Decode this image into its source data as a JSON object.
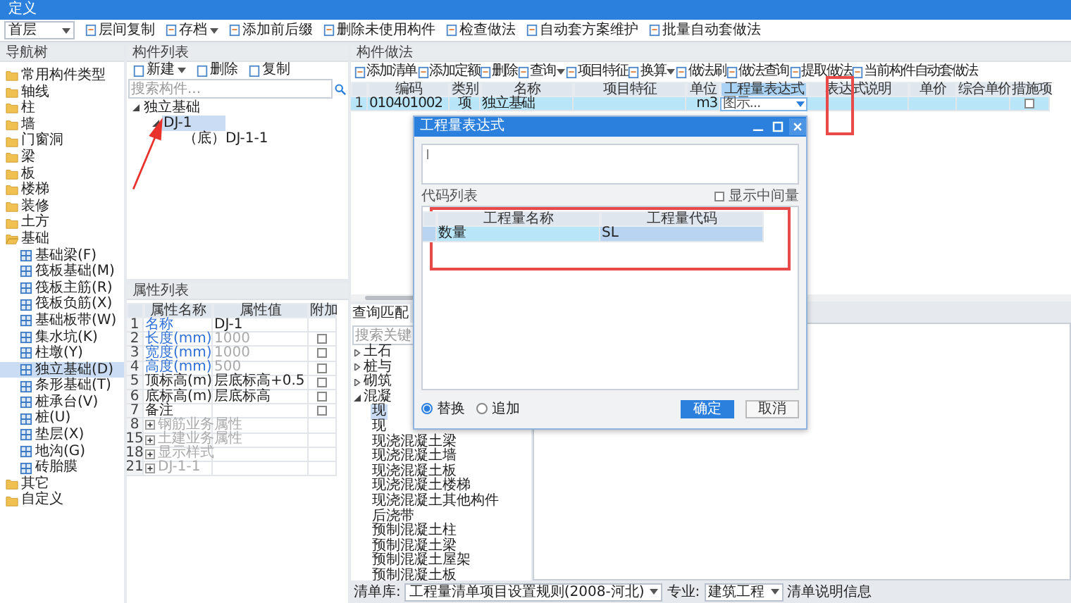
{
  "window": {
    "title": "定义"
  },
  "toolbar": {
    "floor": "首层",
    "buttons": [
      {
        "label": "层间复制",
        "dropdown": false
      },
      {
        "label": "存档",
        "dropdown": true
      },
      {
        "label": "添加前后缀",
        "dropdown": false
      },
      {
        "label": "删除未使用构件",
        "dropdown": false
      },
      {
        "label": "检查做法",
        "dropdown": false
      },
      {
        "label": "自动套方案维护",
        "dropdown": false
      },
      {
        "label": "批量自动套做法",
        "dropdown": false
      }
    ]
  },
  "nav_tree": {
    "title": "导航树",
    "items": [
      {
        "label": "常用构件类型",
        "selected": false,
        "expanded": false
      },
      {
        "label": "轴线",
        "selected": false,
        "expanded": false
      },
      {
        "label": "柱",
        "selected": false,
        "expanded": false
      },
      {
        "label": "墙",
        "selected": false,
        "expanded": false
      },
      {
        "label": "门窗洞",
        "selected": false,
        "expanded": false
      },
      {
        "label": "梁",
        "selected": false,
        "expanded": false
      },
      {
        "label": "板",
        "selected": false,
        "expanded": false
      },
      {
        "label": "楼梯",
        "selected": false,
        "expanded": false
      },
      {
        "label": "装修",
        "selected": false,
        "expanded": false
      },
      {
        "label": "土方",
        "selected": false,
        "expanded": false
      },
      {
        "label": "基础",
        "selected": false,
        "expanded": true,
        "children": [
          {
            "label": "基础梁(F)",
            "selected": false
          },
          {
            "label": "筏板基础(M)",
            "selected": false
          },
          {
            "label": "筏板主筋(R)",
            "selected": false
          },
          {
            "label": "筏板负筋(X)",
            "selected": false
          },
          {
            "label": "基础板带(W)",
            "selected": false
          },
          {
            "label": "集水坑(K)",
            "selected": false
          },
          {
            "label": "柱墩(Y)",
            "selected": false
          },
          {
            "label": "独立基础(D)",
            "selected": true
          },
          {
            "label": "条形基础(T)",
            "selected": false
          },
          {
            "label": "桩承台(V)",
            "selected": false
          },
          {
            "label": "桩(U)",
            "selected": false
          },
          {
            "label": "垫层(X)",
            "selected": false
          },
          {
            "label": "地沟(G)",
            "selected": false
          },
          {
            "label": "砖胎膜",
            "selected": false
          }
        ]
      },
      {
        "label": "其它",
        "selected": false,
        "expanded": false
      },
      {
        "label": "自定义",
        "selected": false,
        "expanded": false
      }
    ]
  },
  "component_list": {
    "title": "构件列表",
    "buttons": [
      {
        "label": "新建",
        "dropdown": true
      },
      {
        "label": "删除",
        "dropdown": false
      },
      {
        "label": "复制",
        "dropdown": false
      }
    ],
    "search": {
      "placeholder": "搜索构件..."
    },
    "tree": [
      {
        "label": "独立基础",
        "selected": false,
        "expanded": true,
        "children": [
          {
            "label": "DJ-1",
            "selected": true,
            "expanded": true,
            "children": [
              {
                "label": "（底）DJ-1-1",
                "selected": false
              }
            ]
          }
        ]
      }
    ]
  },
  "properties": {
    "title": "属性列表",
    "columns": [
      "属性名称",
      "属性值",
      "附加"
    ],
    "rows": [
      {
        "kind": "field",
        "number": "1",
        "name": "名称",
        "linked": true,
        "value": "DJ-1",
        "value_disabled": false
      },
      {
        "kind": "field",
        "number": "2",
        "name": "长度(mm)",
        "linked": true,
        "value": "1000",
        "value_disabled": true,
        "checked": false
      },
      {
        "kind": "field",
        "number": "3",
        "name": "宽度(mm)",
        "linked": true,
        "value": "1000",
        "value_disabled": true,
        "checked": false
      },
      {
        "kind": "field",
        "number": "4",
        "name": "高度(mm)",
        "linked": true,
        "value": "500",
        "value_disabled": true,
        "checked": false
      },
      {
        "kind": "field",
        "number": "5",
        "name": "顶标高(m)",
        "linked": false,
        "value": "层底标高+0.5",
        "value_disabled": false,
        "checked": false
      },
      {
        "kind": "field",
        "number": "6",
        "name": "底标高(m)",
        "linked": false,
        "value": "层底标高",
        "value_disabled": false,
        "checked": false
      },
      {
        "kind": "field",
        "number": "7",
        "name": "备注",
        "linked": false,
        "checked": false
      },
      {
        "kind": "group",
        "number": "8",
        "name": "钢筋业务属性"
      },
      {
        "kind": "group",
        "number": "15",
        "name": "土建业务属性"
      },
      {
        "kind": "group",
        "number": "18",
        "name": "显示样式"
      },
      {
        "kind": "group",
        "number": "21",
        "name": "DJ-1-1"
      }
    ]
  },
  "methods": {
    "title": "构件做法",
    "buttons": [
      {
        "label": "添加清单",
        "dropdown": false
      },
      {
        "label": "添加定额",
        "dropdown": false
      },
      {
        "label": "删除",
        "dropdown": false
      },
      {
        "label": "查询",
        "dropdown": true
      },
      {
        "label": "项目特征",
        "dropdown": false
      },
      {
        "label": "换算",
        "dropdown": true
      },
      {
        "label": "做法刷",
        "dropdown": false
      },
      {
        "label": "做法查询",
        "dropdown": false
      },
      {
        "label": "提取做法",
        "dropdown": false
      },
      {
        "label": "当前构件自动套做法",
        "dropdown": false
      }
    ],
    "columns": [
      {
        "label": "编码",
        "selected": false
      },
      {
        "label": "类别",
        "selected": false
      },
      {
        "label": "名称",
        "selected": false
      },
      {
        "label": "项目特征",
        "selected": false
      },
      {
        "label": "单位",
        "selected": false
      },
      {
        "label": "工程量表达式",
        "selected": true
      },
      {
        "label": "表达式说明",
        "selected": false
      },
      {
        "label": "单价",
        "selected": false
      },
      {
        "label": "综合单价",
        "selected": false
      },
      {
        "label": "措施项",
        "selected": false
      }
    ],
    "rows": [
      {
        "number": "1",
        "code": "010401002",
        "type": "项",
        "name": "独立基础",
        "unit": "m3",
        "expression": "图示...",
        "measure_checked": false,
        "selected": true
      }
    ]
  },
  "query": {
    "tab": "查询匹配",
    "search": {
      "placeholder": "搜索关键"
    },
    "tree": [
      {
        "label": "土石",
        "selected": false,
        "expanded": false
      },
      {
        "label": "桩与",
        "selected": false,
        "expanded": false
      },
      {
        "label": "砌筑",
        "selected": false,
        "expanded": false
      },
      {
        "label": "混凝",
        "selected": false,
        "expanded": true,
        "children": [
          {
            "label": "现",
            "selected": true
          },
          {
            "label": "现",
            "selected": false
          },
          {
            "label": "现浇混凝土梁",
            "selected": false
          },
          {
            "label": "现浇混凝土墙",
            "selected": false
          },
          {
            "label": "现浇混凝土板",
            "selected": false
          },
          {
            "label": "现浇混凝土楼梯",
            "selected": false
          },
          {
            "label": "现浇混凝土其他构件",
            "selected": false
          },
          {
            "label": "后浇带",
            "selected": false
          },
          {
            "label": "预制混凝土柱",
            "selected": false
          },
          {
            "label": "预制混凝土梁",
            "selected": false
          },
          {
            "label": "预制混凝土屋架",
            "selected": false
          },
          {
            "label": "预制混凝土板",
            "selected": false
          }
        ]
      }
    ]
  },
  "bottom_bar": {
    "library_label": "清单库:",
    "library": "工程量清单项目设置规则(2008-河北)",
    "specialty_label": "专业:",
    "specialty": "建筑工程",
    "info": "清单说明信息"
  },
  "dialog": {
    "title": "工程量表达式",
    "list_label": "代码列表",
    "show_intermediate": {
      "label": "显示中间量",
      "checked": false
    },
    "columns": [
      "工程量名称",
      "工程量代码"
    ],
    "rows": [
      {
        "name": "数量",
        "code": "SL",
        "selected": true
      }
    ],
    "modes": [
      {
        "label": "替换",
        "selected": true
      },
      {
        "label": "追加",
        "selected": false
      }
    ],
    "buttons": [
      {
        "label": "确定",
        "kind": "primary"
      },
      {
        "label": "取消",
        "kind": "secondary"
      }
    ]
  }
}
